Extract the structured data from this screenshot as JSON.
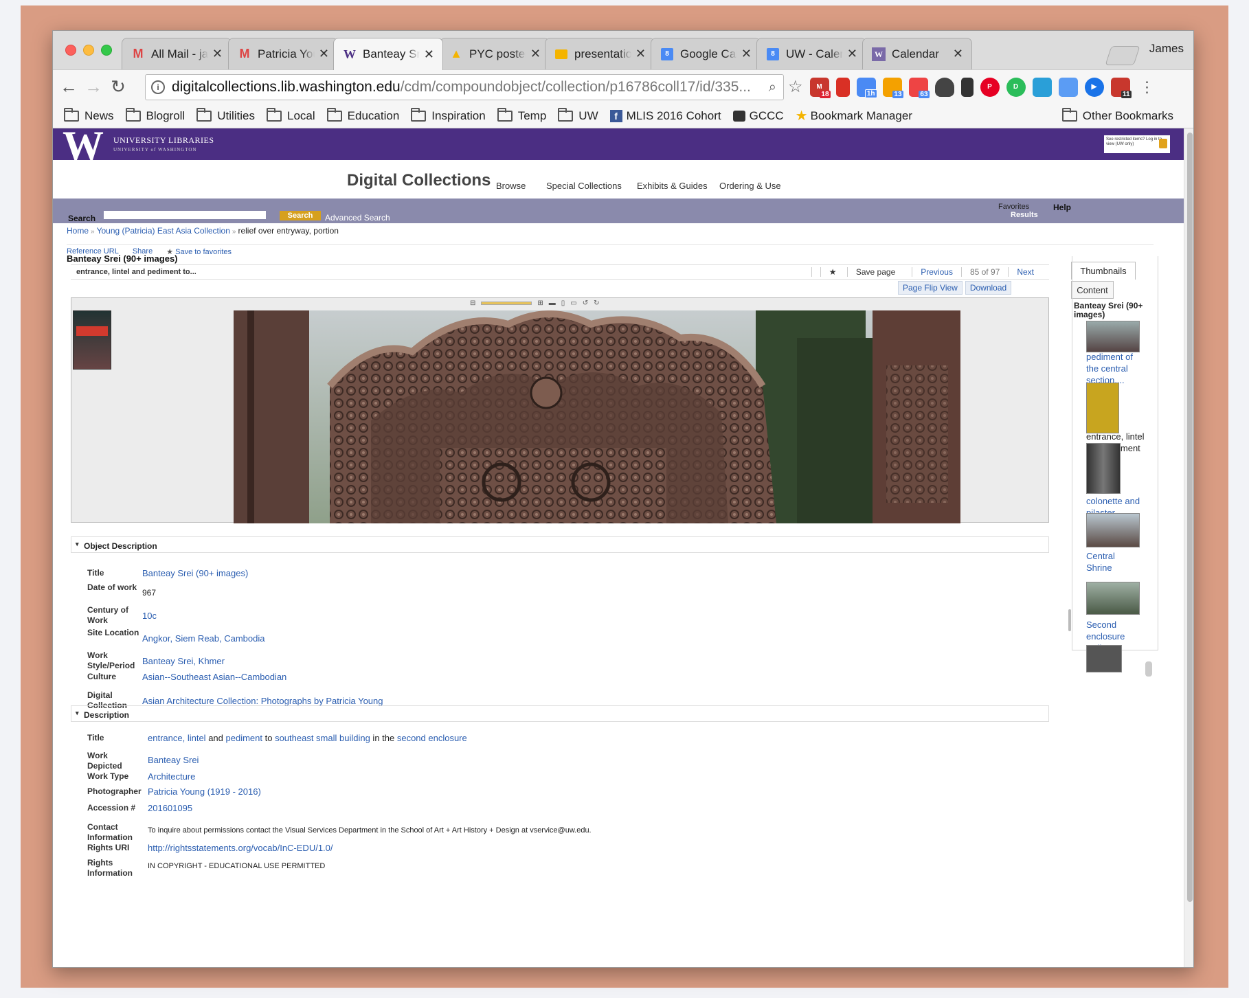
{
  "browser": {
    "tabs": [
      {
        "label": "All Mail - jam",
        "icon": "gmail-icon"
      },
      {
        "label": "Patricia Youn",
        "icon": "gmail-icon"
      },
      {
        "label": "Banteay Srei",
        "icon": "uw-w-icon",
        "active": true
      },
      {
        "label": "PYC poster -",
        "icon": "google-drive-icon"
      },
      {
        "label": "presentation",
        "icon": "google-slides-icon"
      },
      {
        "label": "Google Cale",
        "icon": "google-calendar-icon"
      },
      {
        "label": "UW - Calend",
        "icon": "google-calendar-icon"
      },
      {
        "label": "Calendar",
        "icon": "uw-calendar-icon"
      }
    ],
    "profile": "James",
    "url_domain": "digitalcollections.lib.washington.edu",
    "url_path": "/cdm/compoundobject/collection/p16786coll17/id/335...",
    "extension_badges": {
      "gmail": "18",
      "cal1": "1h",
      "cal2": "13",
      "cal3": "63",
      "cal4": "11"
    },
    "bookmarks": [
      "News",
      "Blogroll",
      "Utilities",
      "Local",
      "Education",
      "Inspiration",
      "Temp",
      "UW"
    ],
    "bookmarks_special": [
      "MLIS 2016 Cohort",
      "GCCC",
      "Bookmark Manager"
    ],
    "other_bookmarks": "Other Bookmarks"
  },
  "site": {
    "library_name": "UNIVERSITY LIBRARIES",
    "library_sub": "UNIVERSITY of WASHINGTON",
    "restricted_note": "See restricted items? Log in to view (UW only)",
    "title": "Digital Collections",
    "menu": [
      "Browse",
      "Special Collections",
      "Exhibits & Guides",
      "Ordering & Use"
    ],
    "search_label": "Search",
    "search_button": "Search",
    "advanced_search": "Advanced Search",
    "favorites": "Favorites",
    "results": "Results",
    "help": "Help"
  },
  "breadcrumb": {
    "home": "Home",
    "collection": "Young (Patricia) East Asia Collection",
    "current": "relief over entryway, portion"
  },
  "actions": {
    "reference_url": "Reference URL",
    "share": "Share",
    "save_favorites": "Save to favorites"
  },
  "page_title": "Banteay Srei (90+ images)",
  "item": {
    "title": "entrance, lintel and pediment to...",
    "save_page": "Save page",
    "previous": "Previous",
    "count": "85 of 97",
    "next": "Next",
    "page_flip": "Page Flip View",
    "download": "Download"
  },
  "sidebar": {
    "tab_thumbnails": "Thumbnails",
    "tab_content": "Content",
    "title": "Banteay Srei (90+ images)",
    "items": [
      "pediment of the central section,...",
      "entrance, lintel and pediment",
      "colonette and pilaster",
      "Central Shrine",
      "Second enclosure wall"
    ]
  },
  "object_description": {
    "heading": "Object Description",
    "fields": [
      {
        "k": "Title",
        "v": "Banteay Srei (90+ images)",
        "link": true
      },
      {
        "k": "Date of work",
        "v": "967",
        "link": false
      },
      {
        "k": "Century of Work",
        "v": "10c",
        "link": true
      },
      {
        "k": "Site Location",
        "v": "Angkor, Siem Reab, Cambodia",
        "link": true
      },
      {
        "k": "Work Style/Period",
        "v": "Banteay Srei, Khmer",
        "link": true
      },
      {
        "k": "Culture",
        "v": "Asian--Southeast Asian--Cambodian",
        "link": true
      },
      {
        "k": "Digital Collection",
        "v": "Asian Architecture Collection: Photographs by Patricia Young",
        "link": true
      }
    ]
  },
  "description": {
    "heading": "Description",
    "title_label": "Title",
    "title_parts": [
      {
        "t": "entrance, ",
        "link": true
      },
      {
        "t": "lintel",
        "link": true
      },
      {
        "t": " and ",
        "link": false
      },
      {
        "t": "pediment",
        "link": true
      },
      {
        "t": " to ",
        "link": false
      },
      {
        "t": "southeast small building",
        "link": true
      },
      {
        "t": " in the ",
        "link": false
      },
      {
        "t": "second enclosure",
        "link": true
      }
    ],
    "fields": [
      {
        "k": "Work Depicted",
        "v": "Banteay Srei",
        "link": true
      },
      {
        "k": "Work Type",
        "v": "Architecture",
        "link": true
      },
      {
        "k": "Photographer",
        "v": "Patricia Young (1919 - 2016)",
        "link": true
      },
      {
        "k": "Accession #",
        "v": "201601095",
        "link": true
      },
      {
        "k": "Contact Information",
        "v": "To inquire about permissions contact the Visual Services Department in the School of Art + Art History + Design at vservice@uw.edu.",
        "link": false
      },
      {
        "k": "Rights URI",
        "v": "http://rightsstatements.org/vocab/InC-EDU/1.0/",
        "link": true
      },
      {
        "k": "Rights Information",
        "v": "IN COPYRIGHT - EDUCATIONAL USE PERMITTED",
        "link": false
      }
    ]
  },
  "colors": {
    "uw_purple": "#4b2e83",
    "search_bar": "#8a8aac",
    "link": "#2a5db0",
    "backdrop": "#d99c83",
    "gold": "#d6a01d"
  }
}
